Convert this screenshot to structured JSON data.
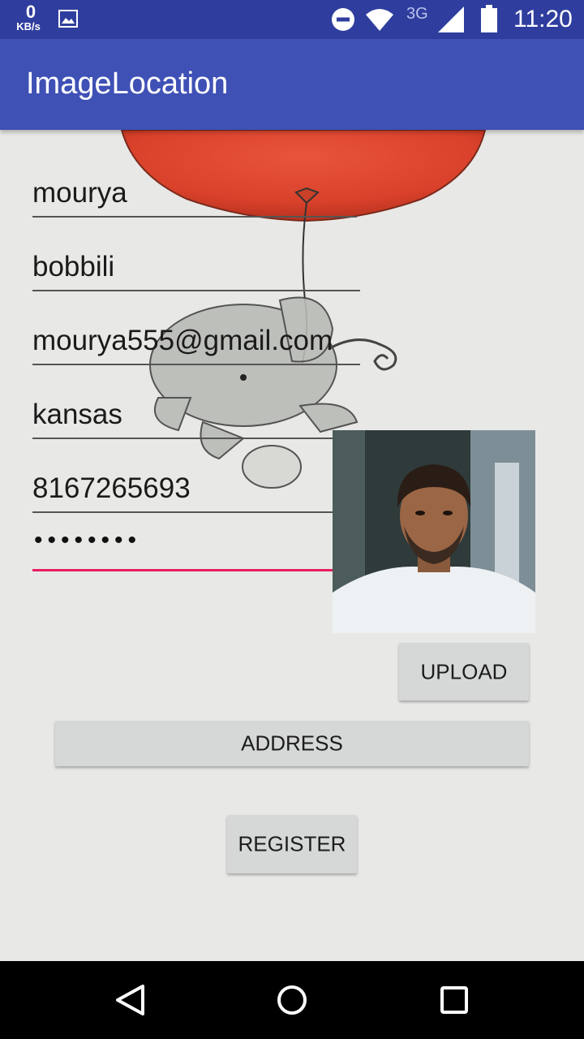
{
  "status_bar": {
    "data_speed_value": "0",
    "data_speed_unit": "KB/s",
    "network_type": "3G",
    "time": "11:20",
    "icons": [
      "image-notification-icon",
      "do-not-disturb-icon",
      "wifi-icon",
      "signal-icon",
      "battery-icon"
    ]
  },
  "app_bar": {
    "title": "ImageLocation",
    "color": "#3f51b5"
  },
  "form": {
    "name": "mourya",
    "last_name": "bobbili",
    "email": "mourya555@gmail.com",
    "city": "kansas",
    "phone": "8167265693",
    "password_mask": "••••••••"
  },
  "buttons": {
    "upload": "UPLOAD",
    "address": "ADDRESS",
    "register": "REGISTER"
  },
  "colors": {
    "accent": "#e91e63",
    "primary": "#3f51b5",
    "primary_dark": "#2f3e9e"
  },
  "nav_bar": {
    "icons": [
      "back-icon",
      "home-icon",
      "recents-icon"
    ]
  }
}
